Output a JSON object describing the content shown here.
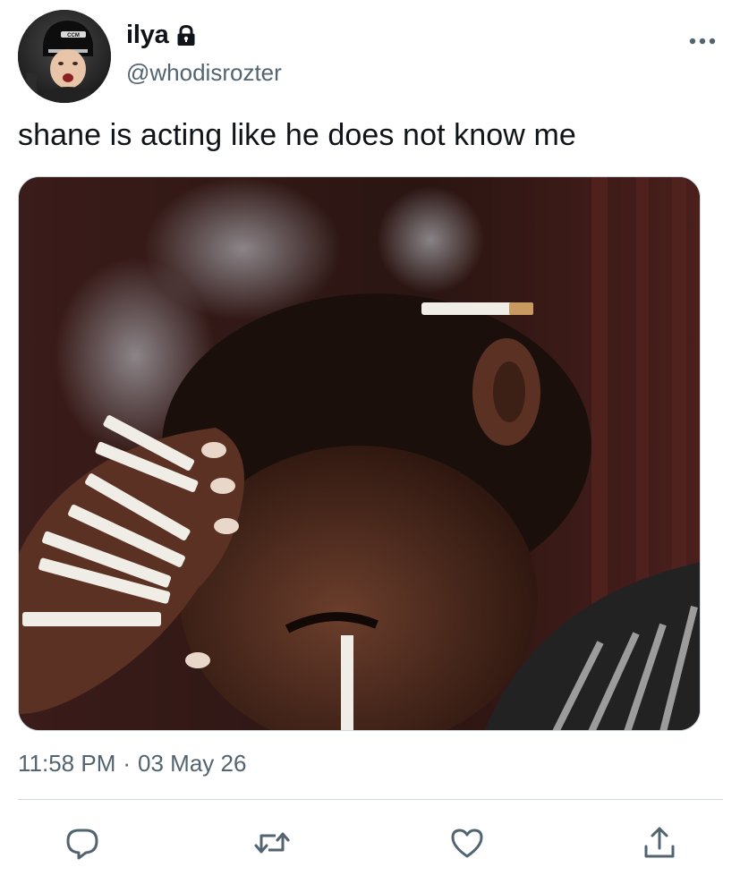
{
  "author": {
    "display_name": "ilya",
    "handle": "@whodisrozter",
    "protected": true,
    "avatar_icon": "avatar-hockey-player"
  },
  "tweet": {
    "text": "shane is acting like he does not know me",
    "time": "11:58 PM",
    "separator": "·",
    "date": "03 May 26"
  },
  "media": {
    "kind": "photo",
    "avatar_helmet_text": "CCM"
  },
  "actions": [
    {
      "name": "reply",
      "icon": "speech-bubble-icon"
    },
    {
      "name": "retweet",
      "icon": "retweet-arrows-icon"
    },
    {
      "name": "like",
      "icon": "heart-icon"
    },
    {
      "name": "share",
      "icon": "share-upload-icon"
    }
  ],
  "colors": {
    "text_primary": "#0f1419",
    "text_secondary": "#536471",
    "divider": "#cfd9de"
  }
}
